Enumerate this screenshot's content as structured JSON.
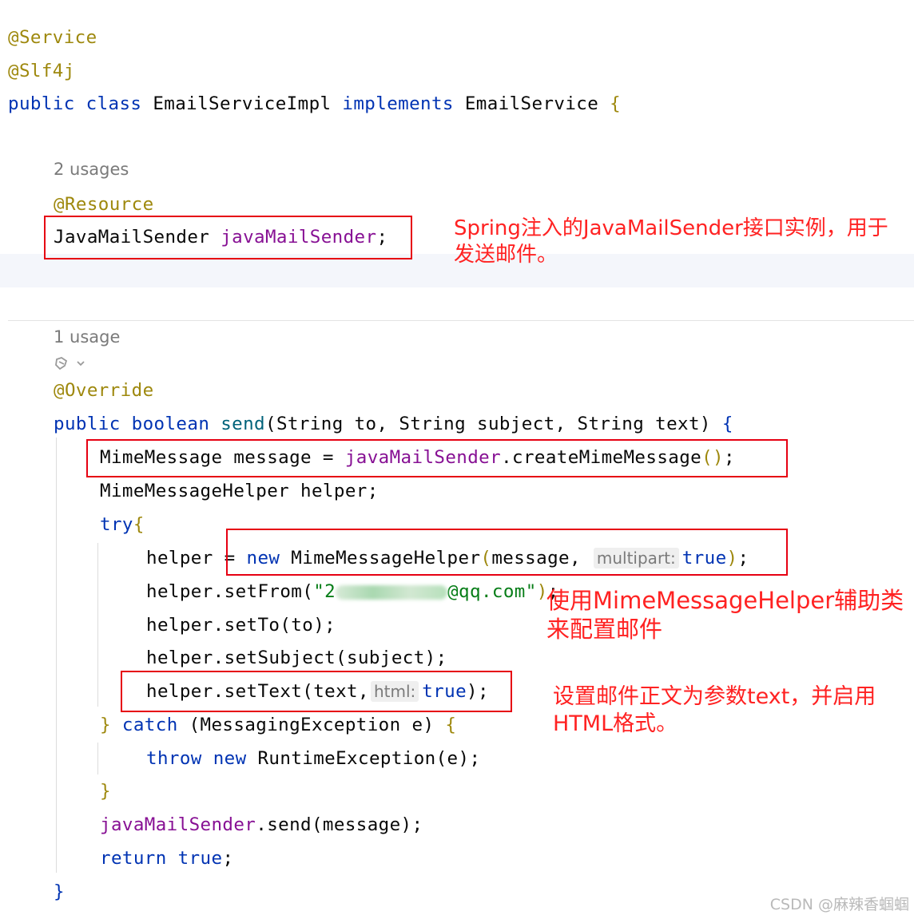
{
  "code": {
    "l1": "@Service",
    "l2": "@Slf4j",
    "l3_kw1": "public",
    "l3_kw2": "class",
    "l3_name": " EmailServiceImpl ",
    "l3_kw3": "implements",
    "l3_iface": " EmailService ",
    "l3_brace": "{",
    "usage1": "2 usages",
    "l_resource": "@Resource",
    "l_field_type": "JavaMailSender ",
    "l_field_name": "javaMailSender",
    "l_field_semi": ";",
    "usage2": "1 usage",
    "l_override": "@Override",
    "send_kw1": "public",
    "send_kw2": "boolean",
    "send_name": "send",
    "send_params": "(String to, String subject, String text) ",
    "send_brace": "{",
    "mm_type": "MimeMessage message = ",
    "mm_field": "javaMailSender",
    "mm_call": ".createMimeMessage",
    "mm_paren": "()",
    "mm_semi": ";",
    "helper_decl": "MimeMessageHelper helper;",
    "try_kw": "try",
    "try_brace": "{",
    "h1_pre": "helper = ",
    "h1_new": "new",
    "h1_cls": " MimeMessageHelper",
    "h1_open": "(",
    "h1_arg": "message,",
    "h1_hint": "multipart:",
    "h1_true": "true",
    "h1_close": ")",
    "h1_semi": ";",
    "h2_pre": "helper.setFrom(",
    "h2_str_start": "\"2",
    "h2_str_end": "@qq.com\"",
    "h2_close": ")",
    "h2_semi": ";",
    "h3": "helper.setTo(to);",
    "h4": "helper.setSubject(subject);",
    "h5_pre": "helper.setText(text,",
    "h5_hint": "html:",
    "h5_true": "true",
    "h5_close": ");",
    "catch_close": "}",
    "catch_kw": "catch",
    "catch_args": " (MessagingException e) ",
    "catch_brace": "{",
    "throw_kw": "throw",
    "throw_new": "new",
    "throw_rest": " RuntimeException(e);",
    "close_catch": "}",
    "send_field": "javaMailSender",
    "send_rest": ".send(message);",
    "ret_kw": "return",
    "ret_true": "true",
    "ret_semi": ";",
    "close_method": "}"
  },
  "annotations": {
    "note1": "Spring注入的JavaMailSender接口实例，用于\n发送邮件。",
    "note2": "使用MimeMessageHelper辅助类\n来配置邮件",
    "note3": "设置邮件正文为参数text，并启用\nHTML格式。"
  },
  "watermark": "CSDN @麻辣香蝈蝈",
  "colors": {
    "keyword": "#0033b3",
    "annotation": "#9e880d",
    "field": "#871094",
    "method": "#00627a",
    "string": "#067d17",
    "callout": "#e60012"
  },
  "icons": {
    "gutter": "ai-assist-icon"
  }
}
